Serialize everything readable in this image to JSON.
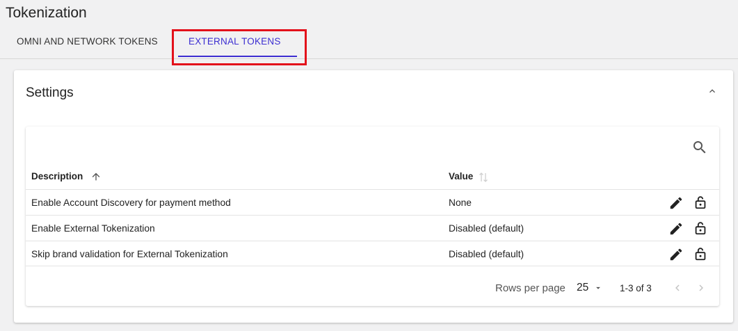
{
  "page": {
    "title": "Tokenization"
  },
  "tabs": [
    {
      "label": "OMNI AND NETWORK TOKENS",
      "active": false
    },
    {
      "label": "EXTERNAL TOKENS",
      "active": true
    }
  ],
  "colors": {
    "accent": "#3c2ed1",
    "highlight": "#e3111b"
  },
  "settings": {
    "title": "Settings",
    "table": {
      "columns": [
        {
          "label": "Description",
          "sort": "ascending"
        },
        {
          "label": "Value",
          "sort": "none"
        }
      ],
      "rows": [
        {
          "description": "Enable Account Discovery for payment method",
          "value": "None"
        },
        {
          "description": "Enable External Tokenization",
          "value": "Disabled (default)"
        },
        {
          "description": "Skip brand validation for External Tokenization",
          "value": "Disabled (default)"
        }
      ],
      "row_icons": [
        "edit-icon",
        "lock-open-icon"
      ]
    },
    "pagination": {
      "rows_per_page_label": "Rows per page",
      "rows_per_page": "25",
      "range": "1-3 of 3"
    }
  }
}
